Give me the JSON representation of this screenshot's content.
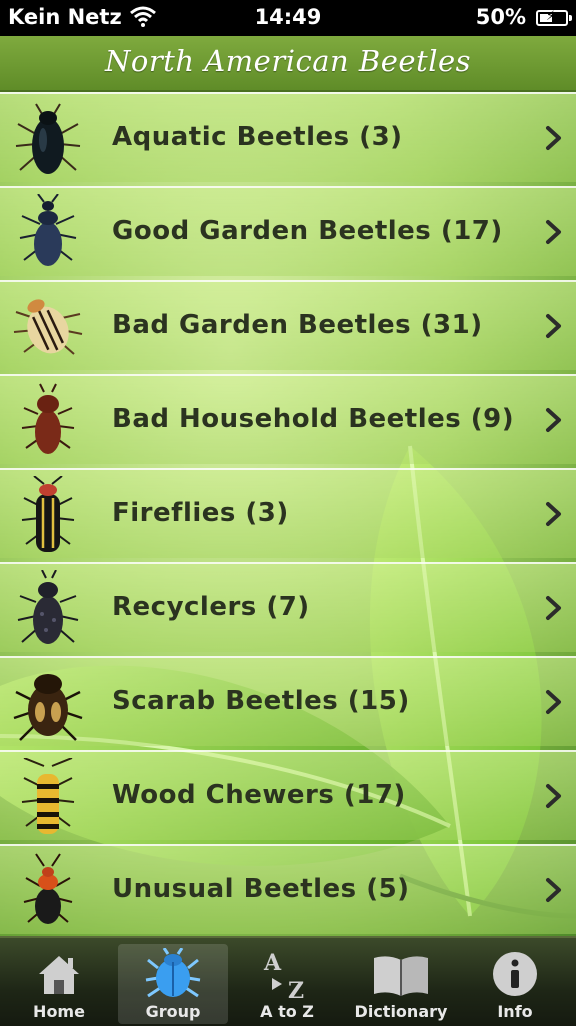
{
  "status_bar": {
    "carrier": "Kein Netz",
    "time": "14:49",
    "battery": "50%",
    "battery_level": 0.5
  },
  "nav": {
    "title": "North American Beetles"
  },
  "groups": [
    {
      "label": "Aquatic Beetles (3)",
      "icon": "aquatic-beetle-icon"
    },
    {
      "label": "Good Garden Beetles (17)",
      "icon": "ground-beetle-icon"
    },
    {
      "label": "Bad Garden Beetles (31)",
      "icon": "potato-beetle-icon"
    },
    {
      "label": "Bad Household Beetles (9)",
      "icon": "household-beetle-icon"
    },
    {
      "label": "Fireflies (3)",
      "icon": "firefly-icon"
    },
    {
      "label": "Recyclers (7)",
      "icon": "recycler-beetle-icon"
    },
    {
      "label": "Scarab Beetles (15)",
      "icon": "scarab-beetle-icon"
    },
    {
      "label": "Wood Chewers (17)",
      "icon": "wood-chewer-beetle-icon"
    },
    {
      "label": "Unusual Beetles (5)",
      "icon": "unusual-beetle-icon"
    }
  ],
  "tabs": [
    {
      "label": "Home",
      "icon": "home-icon",
      "active": false
    },
    {
      "label": "Group",
      "icon": "beetle-icon",
      "active": true
    },
    {
      "label": "A to Z",
      "icon": "a-to-z-icon",
      "active": false
    },
    {
      "label": "Dictionary",
      "icon": "book-icon",
      "active": false
    },
    {
      "label": "Info",
      "icon": "info-icon",
      "active": false
    }
  ]
}
